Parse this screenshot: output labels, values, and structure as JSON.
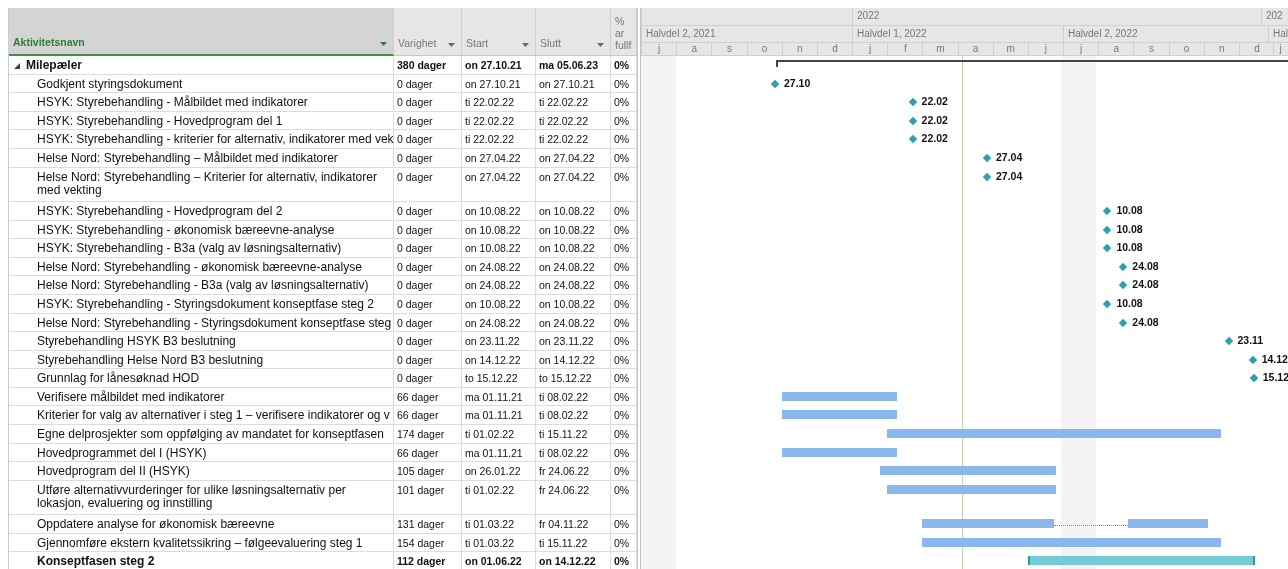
{
  "columns": [
    {
      "label": "Aktivitetsnavn",
      "selected": true,
      "filter": true
    },
    {
      "label": "Varighet",
      "selected": false,
      "filter": true
    },
    {
      "label": "Start",
      "selected": false,
      "filter": true
    },
    {
      "label": "Slutt",
      "selected": false,
      "filter": true
    },
    {
      "label": "% ar",
      "label2": "fullf",
      "selected": false,
      "filter": false
    }
  ],
  "rows": [
    {
      "kind": "group",
      "expanded": true,
      "name": "Milepæler",
      "duration": "380 dager",
      "start": "on 27.10.21",
      "finish": "ma 05.06.23",
      "complete": "0%"
    },
    {
      "kind": "milestone",
      "name": "Godkjent styringsdokument",
      "duration": "0 dager",
      "start": "on 27.10.21",
      "finish": "on 27.10.21",
      "complete": "0%",
      "label": "27.10"
    },
    {
      "kind": "milestone",
      "name": "HSYK: Styrebehandling - Målbildet med indikatorer",
      "duration": "0 dager",
      "start": "ti 22.02.22",
      "finish": "ti 22.02.22",
      "complete": "0%",
      "label": "22.02"
    },
    {
      "kind": "milestone",
      "name": "HSYK: Styrebehandling - Hovedprogram del 1",
      "duration": "0 dager",
      "start": "ti 22.02.22",
      "finish": "ti 22.02.22",
      "complete": "0%",
      "label": "22.02"
    },
    {
      "kind": "milestone",
      "name": "HSYK: Styrebehandling - kriterier for alternativ, indikatorer med vek",
      "duration": "0 dager",
      "start": "ti 22.02.22",
      "finish": "ti 22.02.22",
      "complete": "0%",
      "label": "22.02"
    },
    {
      "kind": "milestone",
      "name": "Helse Nord: Styrebehandling – Målbildet med indikatorer",
      "duration": "0 dager",
      "start": "on 27.04.22",
      "finish": "on 27.04.22",
      "complete": "0%",
      "label": "27.04"
    },
    {
      "kind": "milestone",
      "name": "Helse Nord: Styrebehandling – Kriterier for alternativ, indikatorer med vekting",
      "duration": "0 dager",
      "start": "on 27.04.22",
      "finish": "on 27.04.22",
      "complete": "0%",
      "label": "27.04"
    },
    {
      "kind": "milestone",
      "name": "HSYK: Styrebehandling - Hovedprogram del 2",
      "duration": "0 dager",
      "start": "on 10.08.22",
      "finish": "on 10.08.22",
      "complete": "0%",
      "label": "10.08"
    },
    {
      "kind": "milestone",
      "name": "HSYK: Styrebehandling - økonomisk bæreevne-analyse",
      "duration": "0 dager",
      "start": "on 10.08.22",
      "finish": "on 10.08.22",
      "complete": "0%",
      "label": "10.08"
    },
    {
      "kind": "milestone",
      "name": "HSYK: Styrebehandling - B3a (valg av løsningsalternativ)",
      "duration": "0 dager",
      "start": "on 10.08.22",
      "finish": "on 10.08.22",
      "complete": "0%",
      "label": "10.08"
    },
    {
      "kind": "milestone",
      "name": "Helse Nord: Styrebehandling - økonomisk bæreevne-analyse",
      "duration": "0 dager",
      "start": "on 24.08.22",
      "finish": "on 24.08.22",
      "complete": "0%",
      "label": "24.08"
    },
    {
      "kind": "milestone",
      "name": "Helse Nord: Styrebehandling - B3a (valg av løsningsalternativ)",
      "duration": "0 dager",
      "start": "on 24.08.22",
      "finish": "on 24.08.22",
      "complete": "0%",
      "label": "24.08"
    },
    {
      "kind": "milestone",
      "name": "HSYK: Styrebehandling - Styringsdokument konseptfase steg 2",
      "duration": "0 dager",
      "start": "on 10.08.22",
      "finish": "on 10.08.22",
      "complete": "0%",
      "label": "10.08"
    },
    {
      "kind": "milestone",
      "name": "Helse Nord: Styrebehandling - Styringsdokument konseptfase steg",
      "duration": "0 dager",
      "start": "on 24.08.22",
      "finish": "on 24.08.22",
      "complete": "0%",
      "label": "24.08"
    },
    {
      "kind": "milestone",
      "name": "Styrebehandling HSYK B3 beslutning",
      "duration": "0 dager",
      "start": "on 23.11.22",
      "finish": "on 23.11.22",
      "complete": "0%",
      "label": "23.11"
    },
    {
      "kind": "milestone",
      "name": "Styrebehandling Helse Nord B3 beslutning",
      "duration": "0 dager",
      "start": "on 14.12.22",
      "finish": "on 14.12.22",
      "complete": "0%",
      "label": "14.12"
    },
    {
      "kind": "milestone",
      "name": "Grunnlag for lånesøknad HOD",
      "duration": "0 dager",
      "start": "to 15.12.22",
      "finish": "to 15.12.22",
      "complete": "0%",
      "label": "15.12"
    },
    {
      "kind": "task",
      "name": "Verifisere målbildet med indikatorer",
      "duration": "66 dager",
      "start": "ma 01.11.21",
      "finish": "ti 08.02.22",
      "complete": "0%",
      "split": false
    },
    {
      "kind": "task",
      "name": "Kriterier for valg av alternativer i steg 1 – verifisere indikatorer og v",
      "duration": "66 dager",
      "start": "ma 01.11.21",
      "finish": "ti 08.02.22",
      "complete": "0%",
      "split": false
    },
    {
      "kind": "task",
      "name": "Egne delprosjekter som oppfølging av mandatet for konseptfasen",
      "duration": "174 dager",
      "start": "ti 01.02.22",
      "finish": "ti 15.11.22",
      "complete": "0%",
      "split": false
    },
    {
      "kind": "task",
      "name": "Hovedprogrammet del I (HSYK)",
      "duration": "66 dager",
      "start": "ma 01.11.21",
      "finish": "ti 08.02.22",
      "complete": "0%",
      "split": false
    },
    {
      "kind": "task",
      "name": "Hovedprogram del II (HSYK)",
      "duration": "105 dager",
      "start": "on 26.01.22",
      "finish": "fr 24.06.22",
      "complete": "0%",
      "split": false
    },
    {
      "kind": "task",
      "name": "Utføre alternativvurderinger for ulike løsningsalternativ per lokasjon, evaluering og innstilling",
      "duration": "101 dager",
      "start": "ti 01.02.22",
      "finish": "fr 24.06.22",
      "complete": "0%",
      "split": false
    },
    {
      "kind": "task",
      "name": "Oppdatere analyse for økonomisk bæreevne",
      "duration": "131 dager",
      "start": "ti 01.03.22",
      "finish": "fr 04.11.22",
      "complete": "0%",
      "split": true
    },
    {
      "kind": "task",
      "name": "Gjennomføre ekstern kvalitetssikring – følgeevaluering steg 1",
      "duration": "154 dager",
      "start": "ti 01.03.22",
      "finish": "ti 15.11.22",
      "complete": "0%",
      "split": false
    },
    {
      "kind": "summary",
      "name": "Konseptfasen steg 2",
      "duration": "112 dager",
      "start": "on 01.06.22",
      "finish": "on 14.12.22",
      "complete": "0%"
    }
  ],
  "timescale": {
    "years": [
      "2022",
      "202"
    ],
    "halves": [
      "Halvdel 2, 2021",
      "Halvdel 1, 2022",
      "Halvdel 2, 2022",
      "Hal"
    ],
    "months": [
      "j",
      "a",
      "s",
      "o",
      "n",
      "d",
      "j",
      "f",
      "m",
      "a",
      "m",
      "j",
      "j",
      "a",
      "s",
      "o",
      "n",
      "d",
      "j"
    ]
  }
}
